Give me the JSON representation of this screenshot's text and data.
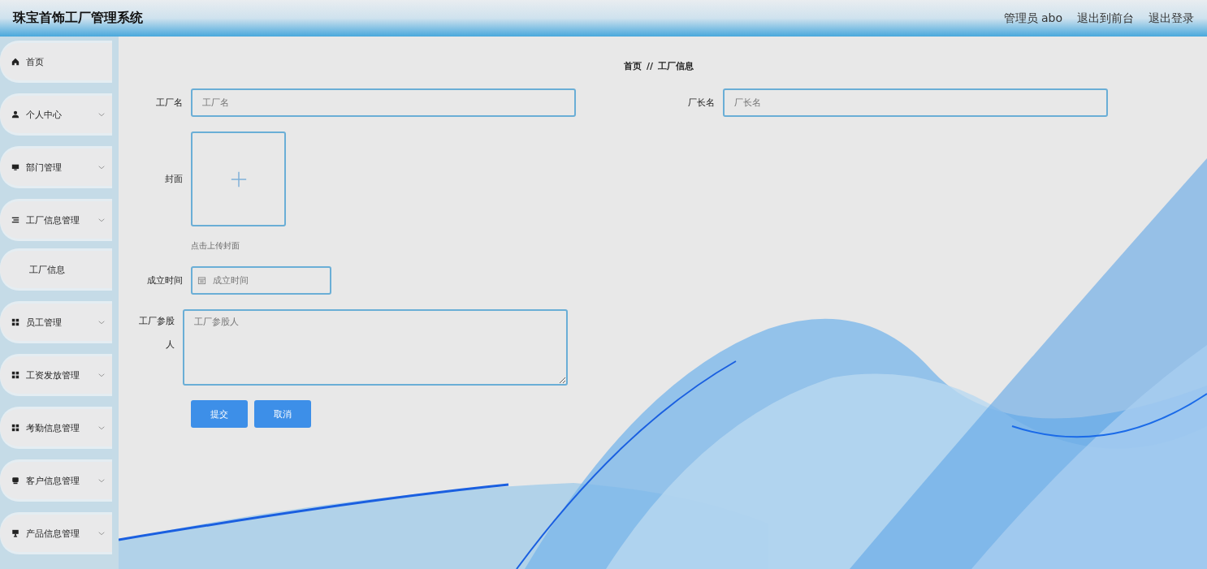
{
  "header": {
    "title": "珠宝首饰工厂管理系统",
    "links": [
      "管理员 abo",
      "退出到前台",
      "退出登录"
    ]
  },
  "sidebar": {
    "items": [
      {
        "label": "首页",
        "kind": "link"
      },
      {
        "label": "个人中心",
        "kind": "menu"
      },
      {
        "label": "部门管理",
        "kind": "menu"
      },
      {
        "label": "工厂信息管理",
        "kind": "menu",
        "children": [
          {
            "label": "工厂信息"
          }
        ]
      },
      {
        "label": "员工管理",
        "kind": "menu"
      },
      {
        "label": "工资发放管理",
        "kind": "menu"
      },
      {
        "label": "考勤信息管理",
        "kind": "menu"
      },
      {
        "label": "客户信息管理",
        "kind": "menu"
      },
      {
        "label": "产品信息管理",
        "kind": "menu"
      }
    ]
  },
  "breadcrumb": {
    "items": [
      "首页",
      "工厂信息"
    ],
    "separator": "//"
  },
  "form": {
    "name_field": {
      "label": "工厂名",
      "placeholder": "工厂名"
    },
    "manager_field": {
      "label": "厂长名",
      "placeholder": "厂长名"
    },
    "cover": {
      "label": "封面",
      "hint": "点击上传封面"
    },
    "date_field": {
      "label": "成立时间",
      "placeholder": "成立时间"
    },
    "shareholder_field": {
      "label": "工厂参股人",
      "placeholder": "工厂参股人"
    },
    "buttons": [
      "提交",
      "取消"
    ]
  }
}
